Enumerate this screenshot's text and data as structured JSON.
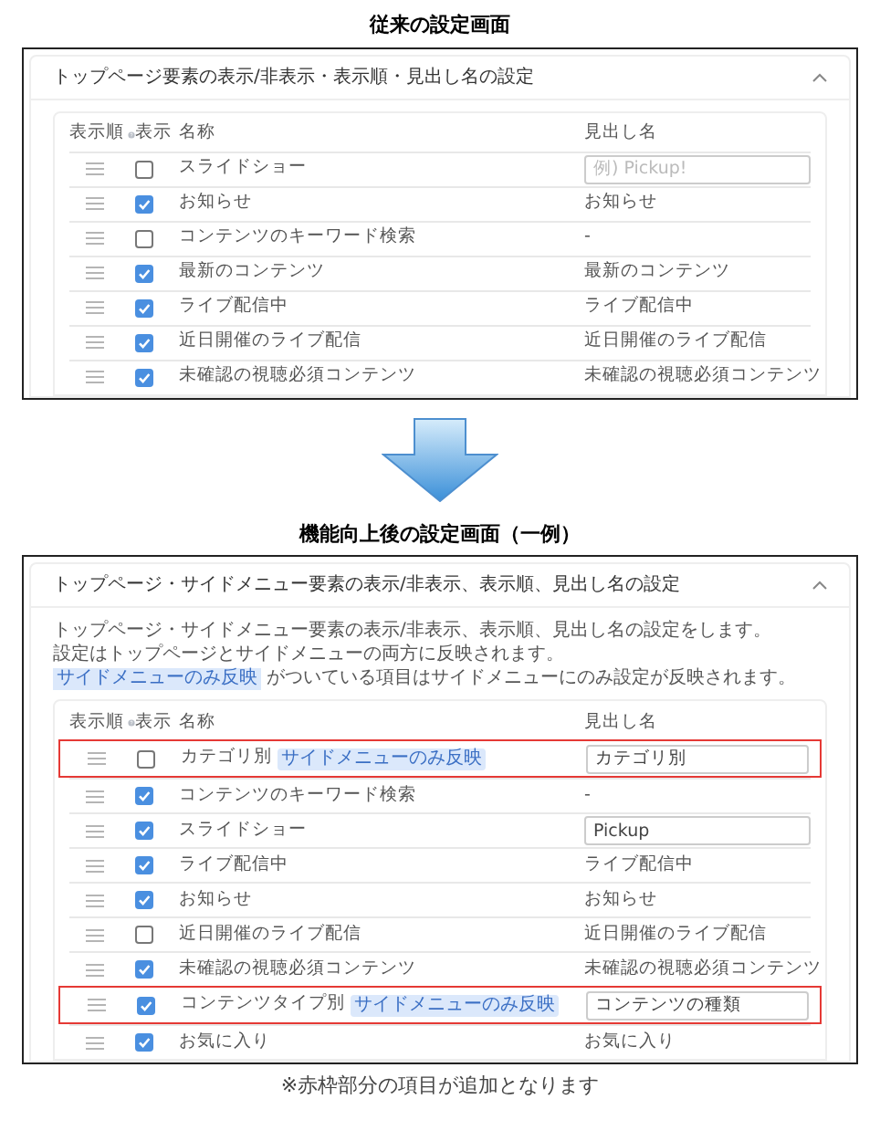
{
  "before": {
    "title": "従来の設定画面",
    "panel_title": "トップページ要素の表示/非表示・表示順・見出し名の設定",
    "expanded": true,
    "columns": [
      "表示順",
      "表示",
      "名称",
      "見出し名"
    ],
    "rows": [
      {
        "name": "スライドショー",
        "checked": false,
        "heading": {
          "kind": "input",
          "placeholder": "例) Pickup!"
        }
      },
      {
        "name": "お知らせ",
        "checked": true,
        "heading": {
          "kind": "text",
          "text": "お知らせ"
        }
      },
      {
        "name": "コンテンツのキーワード検索",
        "checked": false,
        "heading": {
          "kind": "text",
          "text": "-"
        }
      },
      {
        "name": "最新のコンテンツ",
        "checked": true,
        "heading": {
          "kind": "text",
          "text": "最新のコンテンツ"
        }
      },
      {
        "name": "ライブ配信中",
        "checked": true,
        "heading": {
          "kind": "text",
          "text": "ライブ配信中"
        }
      },
      {
        "name": "近日開催のライブ配信",
        "checked": true,
        "heading": {
          "kind": "text",
          "text": "近日開催のライブ配信"
        }
      },
      {
        "name": "未確認の視聴必須コンテンツ",
        "checked": true,
        "heading": {
          "kind": "text",
          "text": "未確認の視聴必須コンテンツ"
        }
      }
    ]
  },
  "after": {
    "title": "機能向上後の設定画面（一例）",
    "panel_title": "トップページ・サイドメニュー要素の表示/非表示、表示順、見出し名の設定",
    "expanded": true,
    "description": [
      "トップページ・サイドメニュー要素の表示/非表示、表示順、見出し名の設定をします。",
      "設定はトップページとサイドメニューの両方に反映されます。"
    ],
    "note": {
      "badge": "サイドメニューのみ反映",
      "text": "がついている項目はサイドメニューにのみ設定が反映されます。"
    },
    "columns": [
      "表示順",
      "表示",
      "名称",
      "見出し名"
    ],
    "rows": [
      {
        "name": "カテゴリ別",
        "badge": "サイドメニューのみ反映",
        "highlighted": true,
        "checked": false,
        "heading": {
          "kind": "input",
          "value": "カテゴリ別"
        }
      },
      {
        "name": "コンテンツのキーワード検索",
        "highlighted": false,
        "checked": true,
        "heading": {
          "kind": "text",
          "text": "-"
        }
      },
      {
        "name": "スライドショー",
        "highlighted": false,
        "checked": true,
        "heading": {
          "kind": "input",
          "value": "Pickup"
        }
      },
      {
        "name": "ライブ配信中",
        "highlighted": false,
        "checked": true,
        "heading": {
          "kind": "text",
          "text": "ライブ配信中"
        }
      },
      {
        "name": "お知らせ",
        "highlighted": false,
        "checked": true,
        "heading": {
          "kind": "text",
          "text": "お知らせ"
        }
      },
      {
        "name": "近日開催のライブ配信",
        "highlighted": false,
        "checked": false,
        "heading": {
          "kind": "text",
          "text": "近日開催のライブ配信"
        }
      },
      {
        "name": "未確認の視聴必須コンテンツ",
        "highlighted": false,
        "checked": true,
        "heading": {
          "kind": "text",
          "text": "未確認の視聴必須コンテンツ"
        }
      },
      {
        "name": "コンテンツタイプ別",
        "badge": "サイドメニューのみ反映",
        "highlighted": true,
        "checked": true,
        "heading": {
          "kind": "input",
          "value": "コンテンツの種類"
        }
      },
      {
        "name": "お気に入り",
        "highlighted": false,
        "checked": true,
        "heading": {
          "kind": "text",
          "text": "お気に入り"
        }
      }
    ]
  },
  "caption": "※赤枠部分の項目が追加となります"
}
